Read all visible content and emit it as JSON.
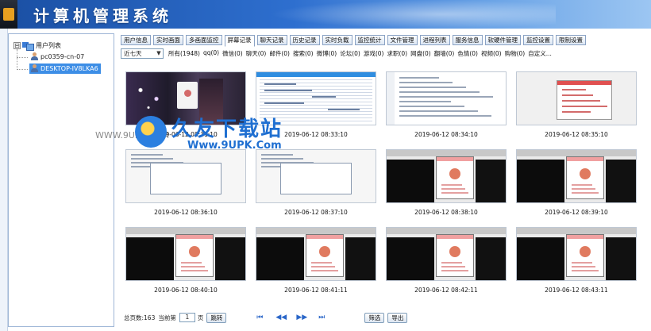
{
  "window": {
    "title": "计算机管理系统"
  },
  "sidebar": {
    "root_label": "用户列表",
    "expander": "⊟",
    "nodes": [
      {
        "label": "pc0359-cn-07",
        "selected": false
      },
      {
        "label": "DESKTOP-IV8LKA6",
        "selected": true
      }
    ]
  },
  "tabs": [
    {
      "label": "用户信息",
      "active": false
    },
    {
      "label": "实时画面",
      "active": false
    },
    {
      "label": "多画面监控",
      "active": false
    },
    {
      "label": "屏幕记录",
      "active": true
    },
    {
      "label": "聊天记录",
      "active": false
    },
    {
      "label": "历史记录",
      "active": false
    },
    {
      "label": "实时负载",
      "active": false
    },
    {
      "label": "监控统计",
      "active": false
    },
    {
      "label": "文件管理",
      "active": false
    },
    {
      "label": "进程列表",
      "active": false
    },
    {
      "label": "服务信息",
      "active": false
    },
    {
      "label": "软硬件管理",
      "active": false
    },
    {
      "label": "监控设置",
      "active": false
    },
    {
      "label": "限制设置",
      "active": false
    }
  ],
  "filter": {
    "range_value": "近七天",
    "categories": [
      "所有(1948)",
      "qq(0)",
      "微信(0)",
      "聊天(0)",
      "邮件(0)",
      "搜索(0)",
      "微博(0)",
      "论坛(0)",
      "游戏(0)",
      "求职(0)",
      "网盘(0)",
      "翻墙(0)",
      "色情(0)",
      "视频(0)",
      "购物(0)",
      "自定义..."
    ]
  },
  "screenshots": [
    {
      "timestamp": "2019-06-12 08:31:10",
      "kind": "photo"
    },
    {
      "timestamp": "2019-06-12 08:33:10",
      "kind": "sheet"
    },
    {
      "timestamp": "2019-06-12 08:34:10",
      "kind": "doc"
    },
    {
      "timestamp": "2019-06-12 08:35:10",
      "kind": "panel"
    },
    {
      "timestamp": "2019-06-12 08:36:10",
      "kind": "dialog"
    },
    {
      "timestamp": "2019-06-12 08:37:10",
      "kind": "dialog"
    },
    {
      "timestamp": "2019-06-12 08:38:10",
      "kind": "dark"
    },
    {
      "timestamp": "2019-06-12 08:39:10",
      "kind": "dark"
    },
    {
      "timestamp": "2019-06-12 08:40:10",
      "kind": "dark"
    },
    {
      "timestamp": "2019-06-12 08:41:11",
      "kind": "dark"
    },
    {
      "timestamp": "2019-06-12 08:42:11",
      "kind": "dark"
    },
    {
      "timestamp": "2019-06-12 08:43:11",
      "kind": "dark"
    }
  ],
  "watermark": {
    "brand": "久友下载站",
    "url": "Www.9UPK.Com",
    "ghost": "WWW.9UPK.COM"
  },
  "pager": {
    "total_label": "总页数:163",
    "current_label": "当前第",
    "current_page": "1",
    "page_suffix": "页",
    "jump_button": "跳转",
    "nav_icons": [
      "first-page-icon",
      "prev-page-icon",
      "next-page-icon",
      "last-page-icon"
    ],
    "filter_button": "筛选",
    "export_button": "导出"
  },
  "colors": {
    "title_bar": "#2e6fcf",
    "selection": "#3d8ee6",
    "accent": "#2a66c8"
  }
}
